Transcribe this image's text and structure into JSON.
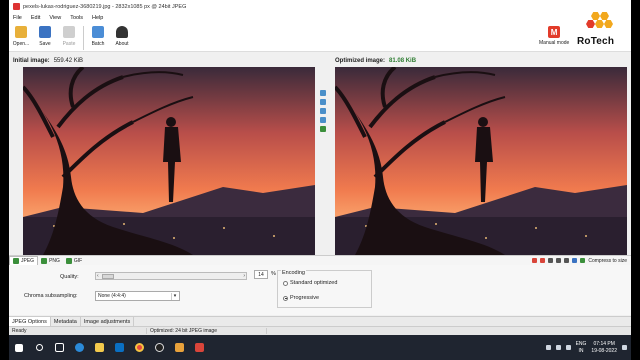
{
  "window": {
    "title": "pexels-lukas-rodriguez-3680219.jpg - 2832x1085 px @ 24bit JPEG"
  },
  "menu": [
    "File",
    "Edit",
    "View",
    "Tools",
    "Help"
  ],
  "toolbar": [
    {
      "label": "Open...",
      "icon": "open-folder-icon",
      "color": "#e8b03a",
      "enabled": true
    },
    {
      "label": "Save",
      "icon": "save-disk-icon",
      "color": "#3b73c2",
      "enabled": true
    },
    {
      "label": "Paste",
      "icon": "paste-icon",
      "color": "#b9b9b9",
      "enabled": false
    },
    {
      "label": "Batch",
      "icon": "batch-icon",
      "color": "#4b8dd6",
      "enabled": true
    },
    {
      "label": "About",
      "icon": "about-person-icon",
      "color": "#333333",
      "enabled": true
    }
  ],
  "mode": {
    "label": "Manual mode",
    "badge": "M",
    "color": "#e23b2a"
  },
  "brand": {
    "name": "RoTech",
    "hex_colors": [
      "#f2a81d",
      "#f2a81d",
      "#e23b2a",
      "#f2a81d",
      "#f2a81d"
    ]
  },
  "initial": {
    "label": "Initial image:",
    "size": "559.42 KiB"
  },
  "optimized": {
    "label": "Optimized image:",
    "size": "81.08 KiB"
  },
  "formats": [
    {
      "label": "JPEG",
      "active": true,
      "color": "#3b8f3b"
    },
    {
      "label": "PNG",
      "active": false,
      "color": "#3b8f3b"
    },
    {
      "label": "GIF",
      "active": false,
      "color": "#3b8f3b"
    }
  ],
  "compress_label": "Compress to size",
  "quality": {
    "label": "Quality:",
    "value": "14",
    "unit": "%"
  },
  "chroma": {
    "label": "Chroma subsampling:",
    "value": "None (4:4:4)"
  },
  "encoding": {
    "legend": "Encoding",
    "options": [
      {
        "label": "Standard optimized",
        "selected": false
      },
      {
        "label": "Progressive",
        "selected": true
      }
    ]
  },
  "bottom_tabs": [
    "JPEG Options",
    "Metadata",
    "Image adjustments"
  ],
  "status": {
    "left": "Ready",
    "right": "Optimized: 24 bit JPEG image"
  },
  "tray": {
    "lang": "ENG",
    "region": "IN",
    "time": "07:14 PM",
    "date": "19-08-2022"
  },
  "taskbar_icons": [
    "windows-start-icon",
    "search-icon",
    "task-view-icon",
    "edge-icon",
    "file-explorer-icon",
    "store-icon",
    "chrome-icon",
    "obs-icon",
    "app-icon",
    "app-icon-2"
  ]
}
